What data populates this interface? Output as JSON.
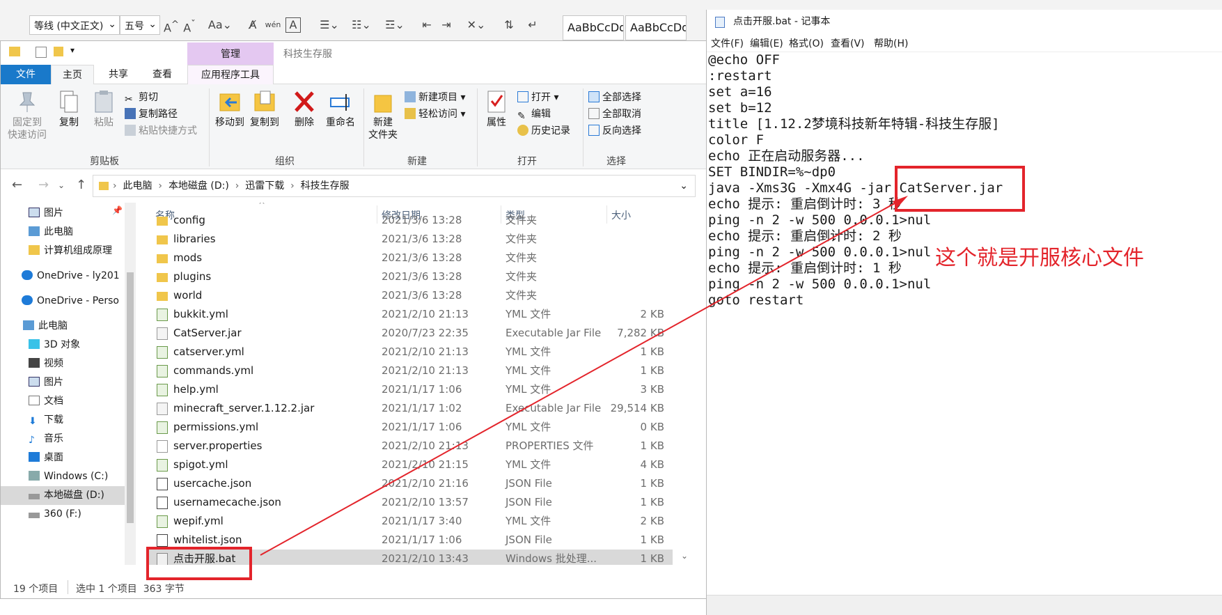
{
  "word": {
    "font_name": "等线 (中文正文)",
    "font_size": "五号",
    "styles": [
      "AaBbCcDd",
      "AaBbCcDd"
    ]
  },
  "explorer": {
    "quick_access_glyph": "▾",
    "manage_tab": "管理",
    "title": "科技生存服",
    "tabs": [
      "文件",
      "主页",
      "共享",
      "查看",
      "应用程序工具"
    ],
    "ribbon": {
      "clipboard": {
        "pin_label": "固定到\n快速访问",
        "copy_label": "复制",
        "paste_label": "粘贴",
        "cut": "剪切",
        "copy_path": "复制路径",
        "paste_shortcut": "粘贴快捷方式",
        "group": "剪贴板"
      },
      "organize": {
        "move_to": "移动到",
        "copy_to": "复制到",
        "delete": "删除",
        "rename": "重命名",
        "group": "组织"
      },
      "new": {
        "new_folder": "新建\n文件夹",
        "new_item": "新建项目",
        "easy_access": "轻松访问",
        "group": "新建"
      },
      "open": {
        "properties": "属性",
        "open": "打开",
        "edit": "编辑",
        "history": "历史记录",
        "group": "打开"
      },
      "select": {
        "select_all": "全部选择",
        "select_none": "全部取消",
        "invert": "反向选择",
        "group": "选择"
      }
    },
    "breadcrumb": [
      "此电脑",
      "本地磁盘 (D:)",
      "迅雷下载",
      "科技生存服"
    ],
    "nav": [
      "图片",
      "此电脑",
      "计算机组成原理",
      "OneDrive - ly201",
      "OneDrive - Perso",
      "此电脑",
      "3D 对象",
      "视频",
      "图片",
      "文档",
      "下载",
      "音乐",
      "桌面",
      "Windows (C:)",
      "本地磁盘 (D:)",
      "360 (F:)"
    ],
    "columns": [
      "名称",
      "修改日期",
      "类型",
      "大小"
    ],
    "files": [
      {
        "name": "config",
        "date": "2021/3/6 13:28",
        "type": "文件夹",
        "size": ""
      },
      {
        "name": "libraries",
        "date": "2021/3/6 13:28",
        "type": "文件夹",
        "size": ""
      },
      {
        "name": "mods",
        "date": "2021/3/6 13:28",
        "type": "文件夹",
        "size": ""
      },
      {
        "name": "plugins",
        "date": "2021/3/6 13:28",
        "type": "文件夹",
        "size": ""
      },
      {
        "name": "world",
        "date": "2021/3/6 13:28",
        "type": "文件夹",
        "size": ""
      },
      {
        "name": "bukkit.yml",
        "date": "2021/2/10 21:13",
        "type": "YML 文件",
        "size": "2 KB"
      },
      {
        "name": "CatServer.jar",
        "date": "2020/7/23 22:35",
        "type": "Executable Jar File",
        "size": "7,282 KB"
      },
      {
        "name": "catserver.yml",
        "date": "2021/2/10 21:13",
        "type": "YML 文件",
        "size": "1 KB"
      },
      {
        "name": "commands.yml",
        "date": "2021/2/10 21:13",
        "type": "YML 文件",
        "size": "1 KB"
      },
      {
        "name": "help.yml",
        "date": "2021/1/17 1:06",
        "type": "YML 文件",
        "size": "3 KB"
      },
      {
        "name": "minecraft_server.1.12.2.jar",
        "date": "2021/1/17 1:02",
        "type": "Executable Jar File",
        "size": "29,514 KB"
      },
      {
        "name": "permissions.yml",
        "date": "2021/1/17 1:06",
        "type": "YML 文件",
        "size": "0 KB"
      },
      {
        "name": "server.properties",
        "date": "2021/2/10 21:13",
        "type": "PROPERTIES 文件",
        "size": "1 KB"
      },
      {
        "name": "spigot.yml",
        "date": "2021/2/10 21:15",
        "type": "YML 文件",
        "size": "4 KB"
      },
      {
        "name": "usercache.json",
        "date": "2021/2/10 21:16",
        "type": "JSON File",
        "size": "1 KB"
      },
      {
        "name": "usernamecache.json",
        "date": "2021/2/10 13:57",
        "type": "JSON File",
        "size": "1 KB"
      },
      {
        "name": "wepif.yml",
        "date": "2021/1/17 3:40",
        "type": "YML 文件",
        "size": "2 KB"
      },
      {
        "name": "whitelist.json",
        "date": "2021/1/17 1:06",
        "type": "JSON File",
        "size": "1 KB"
      },
      {
        "name": "点击开服.bat",
        "date": "2021/2/10 13:43",
        "type": "Windows 批处理...",
        "size": "1 KB"
      }
    ],
    "status_left": "19 个项目",
    "status_sel": "选中 1 个项目  363 字节"
  },
  "notepad": {
    "title": "点击开服.bat - 记事本",
    "menu": [
      "文件(F)",
      "编辑(E)",
      "格式(O)",
      "查看(V)",
      "帮助(H)"
    ],
    "lines": [
      "@echo OFF",
      ":restart",
      "set a=16",
      "set b=12",
      "title [1.12.2梦境科技新年特辑-科技生存服]",
      "color F",
      "echo 正在启动服务器...",
      "SET BINDIR=%~dp0",
      "java -Xms3G -Xmx4G -jar CatServer.jar",
      "echo 提示: 重启倒计时: 3 秒",
      "ping -n 2 -w 500 0.0.0.1>nul",
      "echo 提示: 重启倒计时: 2 秒",
      "ping -n 2 -w 500 0.0.0.1>nul",
      "echo 提示: 重启倒计时: 1 秒",
      "ping -n 2 -w 500 0.0.0.1>nul",
      "goto restart"
    ]
  },
  "annotation": {
    "text": "这个就是开服核心文件",
    "color": "#e3242b"
  }
}
